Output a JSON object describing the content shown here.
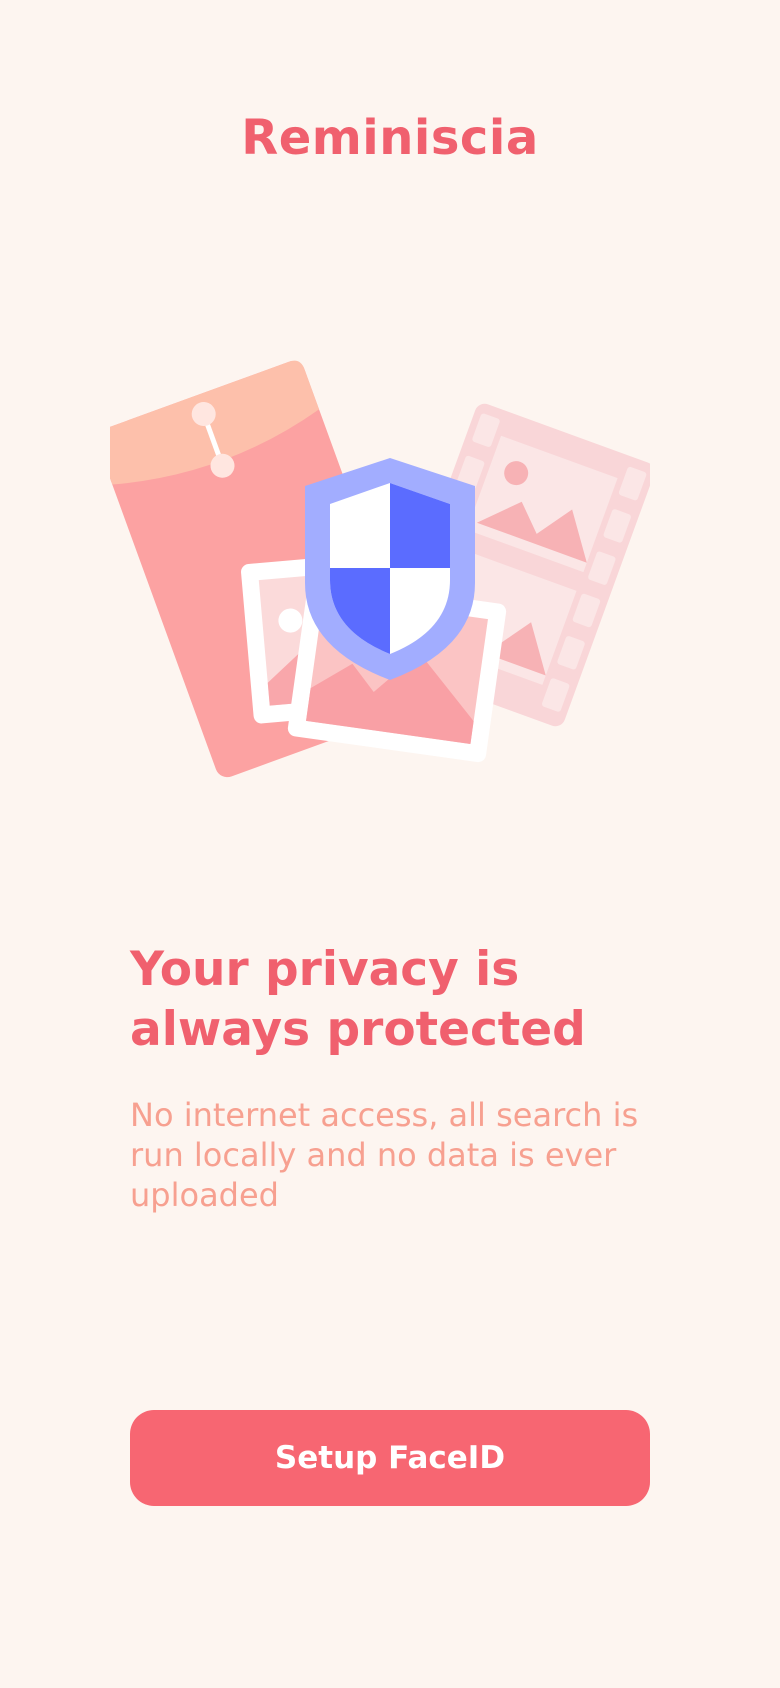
{
  "app": {
    "title": "Reminiscia"
  },
  "onboarding": {
    "headline_line1": "Your privacy is",
    "headline_line2": "always protected",
    "description": "No internet access, all search is run locally and no data is ever uploaded",
    "cta_label": "Setup FaceID"
  },
  "illustration": {
    "icons": [
      "envelope-icon",
      "film-strip-icon",
      "photo-icon",
      "shield-icon"
    ]
  },
  "colors": {
    "background": "#fdf5f0",
    "brand": "#f0606e",
    "button": "#f76672",
    "subtext": "#f7a090",
    "shield": "#5b6cff"
  }
}
